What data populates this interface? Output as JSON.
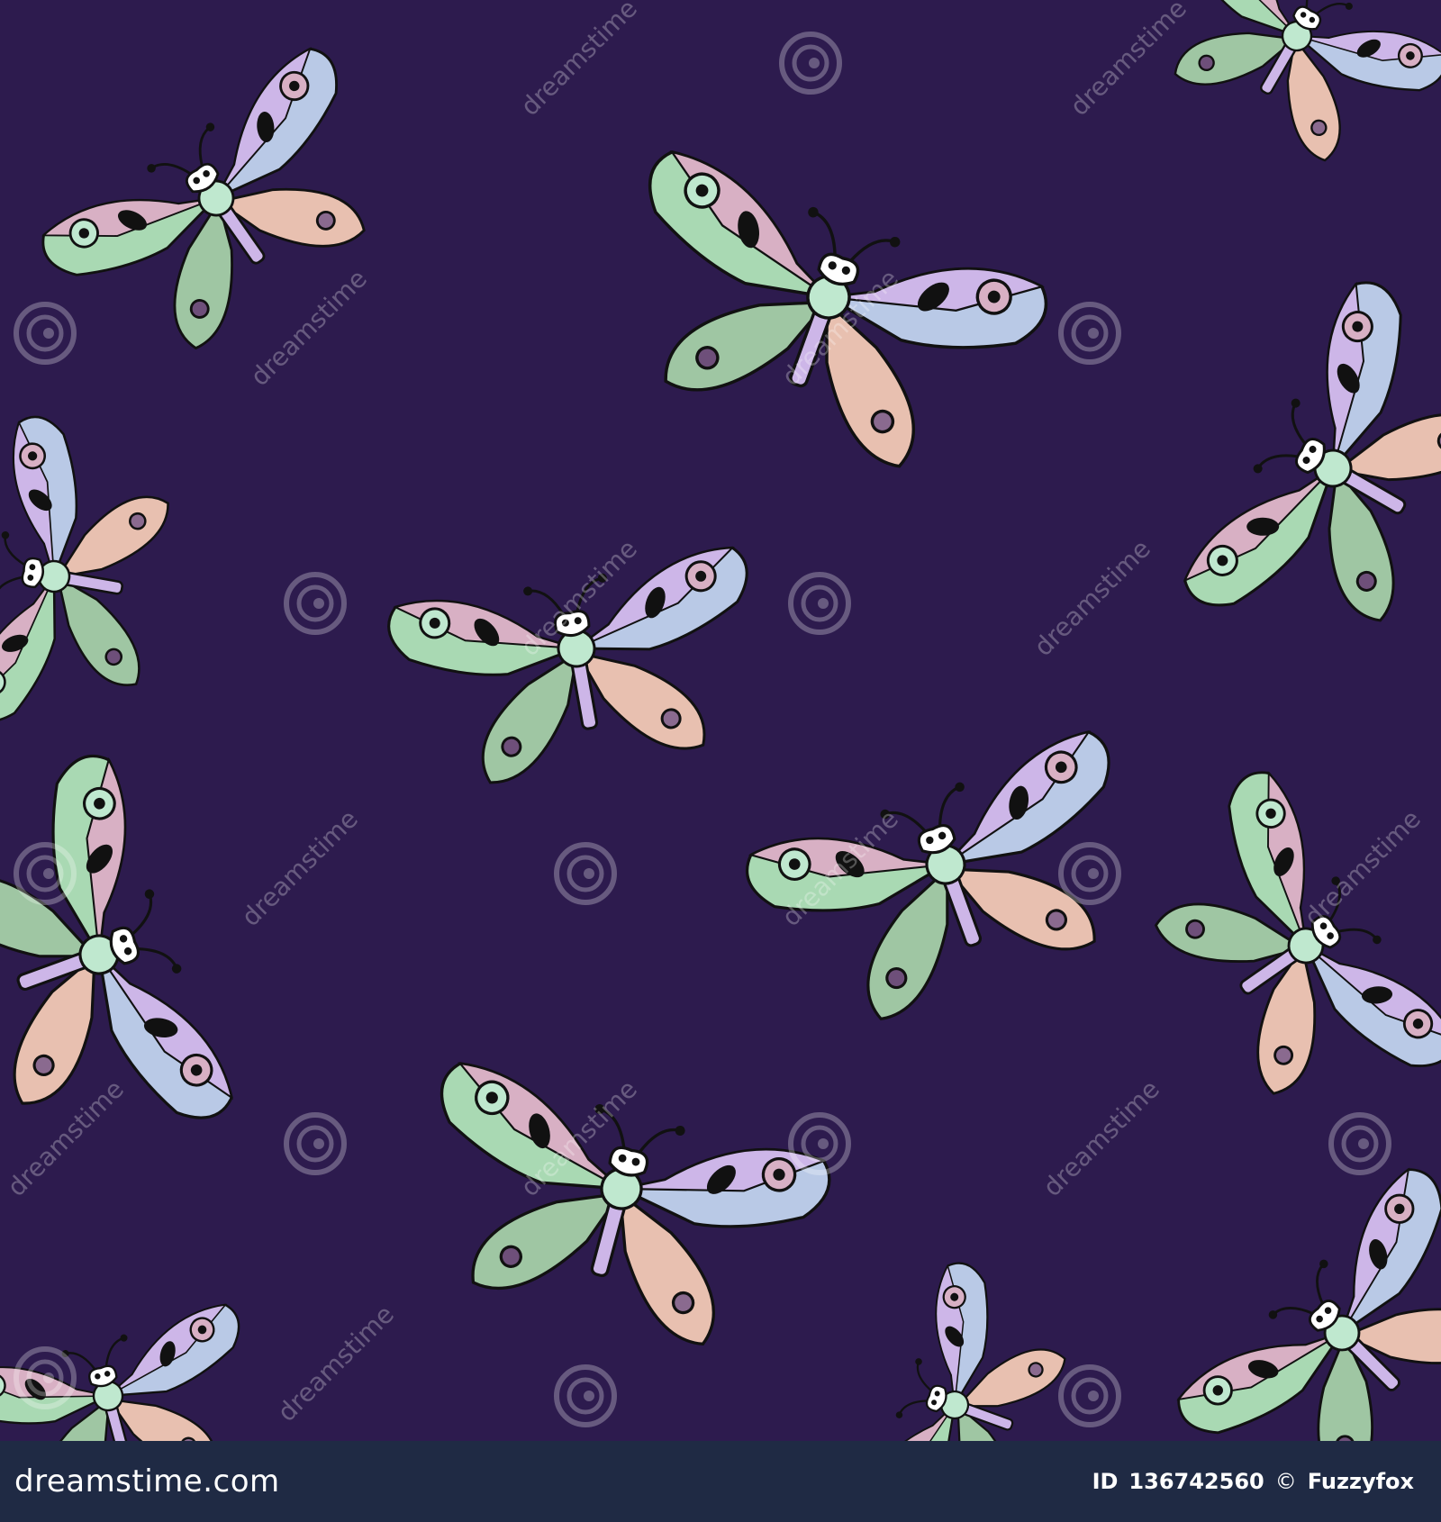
{
  "colors": {
    "background": "#2d1b4e",
    "footer_bg": "#1f2a44",
    "palette": [
      "#a9d9b3",
      "#d8b0c4",
      "#b9c9e6",
      "#cdb6e8",
      "#e8c0b0",
      "#9fc6a3",
      "#8a6a8f",
      "#bfe8cf",
      "#6e4f7a"
    ]
  },
  "watermark": {
    "text": "dreamstime",
    "icon": "spiral-icon"
  },
  "footer": {
    "brand": "dreamstime.com",
    "id_label": "ID",
    "id_value": "136742560",
    "copyright_symbol": "©",
    "author": "Fuzzyfox"
  }
}
